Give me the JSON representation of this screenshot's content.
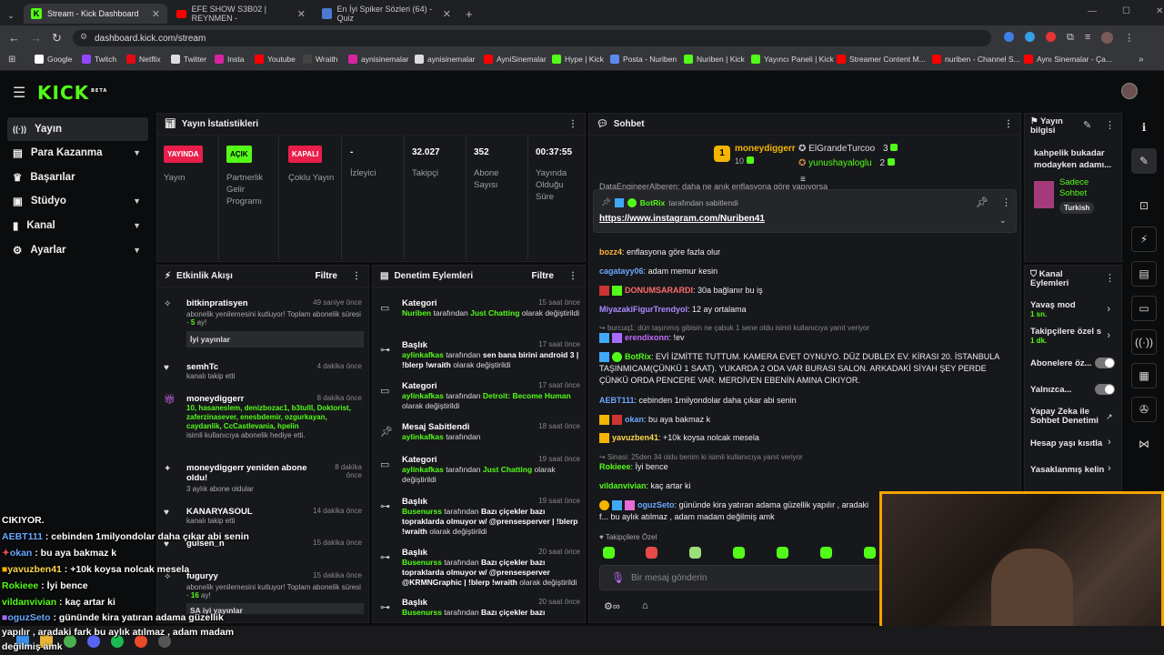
{
  "browser": {
    "tabs": [
      {
        "title": "Stream - Kick Dashboard",
        "active": true
      },
      {
        "title": "EFE SHOW S3B02 | REYNMEN -",
        "active": false
      },
      {
        "title": "En İyi Spiker Sözleri (64) - Quiz",
        "active": false
      }
    ],
    "url": "dashboard.kick.com/stream",
    "bookmarks": [
      "Google",
      "Twitch",
      "Netflix",
      "Twitter",
      "Insta",
      "Youtube",
      "Wraith",
      "aynisinemalar",
      "aynisinemalar",
      "AyniSinemalar",
      "Hype | Kick",
      "Posta - Nuriben",
      "Nuriben | Kick",
      "Yayıncı Paneli | Kick",
      "Streamer Content M...",
      "nuriben - Channel S...",
      "Aynı Sinemalar - Ça..."
    ]
  },
  "brand": {
    "logo": "KICK",
    "beta": "BETA",
    "accent": "#53fc18"
  },
  "sidebar": {
    "items": [
      {
        "label": "Yayın"
      },
      {
        "label": "Para Kazanma"
      },
      {
        "label": "Başarılar"
      },
      {
        "label": "Stüdyo"
      },
      {
        "label": "Kanal"
      },
      {
        "label": "Ayarlar"
      }
    ]
  },
  "stats": {
    "title": "Yayın İstatistikleri",
    "cells": [
      {
        "badge": "YAYINDA",
        "label": "Yayın"
      },
      {
        "badge": "AÇIK",
        "label": "Partnerlik Gelir Programı"
      },
      {
        "badge": "KAPALI",
        "label": "Çoklu Yayın"
      },
      {
        "value": "-",
        "label": "İzleyici"
      },
      {
        "value": "32.027",
        "label": "Takipçi"
      },
      {
        "value": "352",
        "label": "Abone Sayısı"
      },
      {
        "value": "00:37:55",
        "label": "Yayında Olduğu Süre"
      }
    ]
  },
  "activity": {
    "title": "Etkinlik Akışı",
    "filter": "Filtre",
    "items": [
      {
        "name": "bitkinpratisyen",
        "time": "49 saniye önce",
        "text": "abonelik yenilemesini kutluyor! Toplam abonelik süresi - ",
        "count": "5",
        "suffix": " ay!",
        "msg": "İyi yayınlar"
      },
      {
        "name": "semhTc",
        "time": "4 dakika önce",
        "text": "kanalı takip etti"
      },
      {
        "name": "moneydiggerr",
        "time": "8 dakika önce",
        "gift": "10, hasaneslem, denizbozac1, b3tulll, Doktorist, zaferzinasever, enesbdemir, ozgurkayan, caydanlik, CcCastlevania, hpelin",
        "text": "isimli kullanıcıya abonelik hediye etti."
      },
      {
        "name": "moneydiggerr yeniden abone oldu!",
        "time": "8 dakika önce",
        "text": "3 aylık abone oldular"
      },
      {
        "name": "KANARYASOUL",
        "time": "14 dakika önce",
        "text": "kanalı takip etti"
      },
      {
        "name": "gulsen_n",
        "time": "15 dakika önce",
        "text": ""
      },
      {
        "name": "fuguryy",
        "time": "15 dakika önce",
        "text": "abonelik yenilemesini kutluyor! Toplam abonelik süresi - ",
        "count": "16",
        "suffix": " ay!",
        "msg": "SA iyi yayınlar"
      }
    ]
  },
  "moderation": {
    "title": "Denetim Eylemleri",
    "filter": "Filtre",
    "items": [
      {
        "type": "Kategori",
        "time": "15 saat önce",
        "actor": "Nuriben",
        "mid": " tarafından ",
        "target": "Just Chatting",
        "end": " olarak değiştirildi"
      },
      {
        "type": "Başlık",
        "time": "17 saat önce",
        "actor": "aylinkafkas",
        "mid": " tarafından ",
        "target": "sen bana birini android 3 | !blerp !wraith",
        "end": " olarak değiştirildi"
      },
      {
        "type": "Kategori",
        "time": "17 saat önce",
        "actor": "aylinkafkas",
        "mid": " tarafından ",
        "target": "Detroit: Become Human",
        "end": " olarak değiştirildi"
      },
      {
        "type": "Mesaj Sabitlendi",
        "time": "18 saat önce",
        "actor": "aylinkafkas",
        "mid": " tarafından",
        "target": "",
        "end": ""
      },
      {
        "type": "Kategori",
        "time": "19 saat önce",
        "actor": "aylinkafkas",
        "mid": " tarafından ",
        "target": "Just Chatting",
        "end": " olarak değiştirildi"
      },
      {
        "type": "Başlık",
        "time": "19 saat önce",
        "actor": "Busenurss",
        "mid": " tarafından ",
        "target": "Bazı çiçekler bazı topraklarda olmuyor w/ @prensesperver | !blerp !wraith",
        "end": " olarak değiştirildi"
      },
      {
        "type": "Başlık",
        "time": "20 saat önce",
        "actor": "Busenurss",
        "mid": " tarafından ",
        "target": "Bazı çiçekler bazı topraklarda olmuyor w/ @prensesperver @KRMNGraphic | !blerp !wraith",
        "end": " olarak değiştirildi"
      },
      {
        "type": "Başlık",
        "time": "20 saat önce",
        "actor": "Busenurss",
        "mid": " tarafından ",
        "target": "Bazı çiçekler bazı",
        "end": ""
      }
    ]
  },
  "chat": {
    "title": "Sohbet",
    "leaders": [
      {
        "rank": "1",
        "name": "moneydiggerr",
        "count": "10"
      },
      {
        "name": "ElGrandeTurcoo",
        "count": "3"
      },
      {
        "name": "yunushayaloglu",
        "count": "2"
      }
    ],
    "pinned": {
      "user": "BotRix",
      "note": "tarafından sabitlendi",
      "link": "https://www.instagram.com/Nuriben41"
    },
    "partial_top": "DataEngineerAlberen: daha ne anık enflasyona göre yapıyorsa",
    "lines": [
      {
        "user": "bozz4",
        "color": "#ffb43a",
        "text": "enflasyona göre fazla olur"
      },
      {
        "user": "cagatayy06",
        "color": "#6aa8ff",
        "text": "adam memur kesin"
      },
      {
        "user": "DONUMSARARDI",
        "color": "#ff6b6b",
        "text": "30a bağlanır bu iş"
      },
      {
        "user": "MiyazakiFigurTrendyol",
        "color": "#a98bff",
        "text": "12 ay ortalama"
      },
      {
        "reply": "burcuq1: dün taşınmış gibisin ne çabuk 1 sene oldu isimli kullanıcıya yanıt veriyor"
      },
      {
        "user": "erendixonn",
        "color": "#c46bff",
        "text": "!ev"
      },
      {
        "user": "BotRix",
        "color": "#53fc18",
        "text": "EVİ İZMİTTE TUTTUM. KAMERA EVET OYNUYO. DÜZ DUBLEX EV. KİRASI 20. İSTANBULA TAŞINMICAM(ÇÜNKÜ 1 SAAT). YUKARDA 2 ODA VAR BURASI SALON. ARKADAKİ SİYAH ŞEY PERDE ÇÜNKÜ ORDA PENCERE VAR. MERDİVEN EBENİN AMINA CIKIYOR."
      },
      {
        "user": "AEBT111",
        "color": "#6aa8ff",
        "text": "cebinden 1milyondolar daha çıkar abi senin"
      },
      {
        "user": "okan",
        "color": "#6aa8ff",
        "text": "bu aya bakmaz k"
      },
      {
        "user": "yavuzben41",
        "color": "#ffd84a",
        "text": "+10k koysa nolcak mesela"
      },
      {
        "reply": "Sinasi: 25den 34 oldu benim ki isimli kullanıcıya yanıt veriyor"
      },
      {
        "user": "Rokieee",
        "color": "#53fc18",
        "text": "İyi bence"
      },
      {
        "user": "vildanvivian",
        "color": "#53fc18",
        "text": "kaç artar ki"
      },
      {
        "user": "oguzSeto",
        "color": "#6aa8ff",
        "text": "gününde kira yatıran adama güzellik yapılır , aradaki f... bu aylık atılmaz , adam madam değilmiş amk"
      }
    ],
    "followers_only": "Takipçilere Özel",
    "input_placeholder": "Bir mesaj gönderin"
  },
  "stream_info": {
    "title": "Yayın bilgisi",
    "stream_title": "kahpelik bukadar modayken adamı...",
    "category": "Sadece Sohbet",
    "language": "Turkish"
  },
  "channel_actions": {
    "title": "Kanal Eylemleri",
    "items": [
      {
        "label": "Yavaş mod",
        "sub": "1 sn.",
        "kind": "chev"
      },
      {
        "label": "Takipçilere özel s",
        "sub": "1 dk.",
        "kind": "chev"
      },
      {
        "label": "Abonelere öz...",
        "kind": "toggle"
      },
      {
        "label": "Yalnızca...",
        "kind": "toggle"
      },
      {
        "label": "Yapay Zeka ile Sohbet Denetimi",
        "kind": "ext"
      },
      {
        "label": "Hesap yaşı kısıtla",
        "kind": "chev"
      },
      {
        "label": "Yasaklanmış kelin",
        "kind": "chev"
      }
    ]
  },
  "overlay": {
    "lines": [
      {
        "text": "CIKIYOR."
      },
      {
        "user": "AEBT111",
        "color": "#6aa8ff",
        "text": " : cebinden 1milyondolar daha çıkar abi senin"
      },
      {
        "user": "okan",
        "color": "#6aa8ff",
        "text": " : bu aya bakmaz k"
      },
      {
        "user": "yavuzben41",
        "color": "#ffd84a",
        "text": " : +10k koysa nolcak mesela"
      },
      {
        "user": "Rokieee",
        "color": "#53fc18",
        "text": " : İyi bence"
      },
      {
        "user": "vildanvivian",
        "color": "#53fc18",
        "text": " : kaç artar ki"
      },
      {
        "user": "oguzSeto",
        "color": "#6aa8ff",
        "text": " : gününde kira yatıran adama güzellik"
      },
      {
        "text": "yapılır , aradaki fark bu aylık atılmaz , adam madam"
      },
      {
        "text": "değilmiş amk"
      }
    ]
  }
}
